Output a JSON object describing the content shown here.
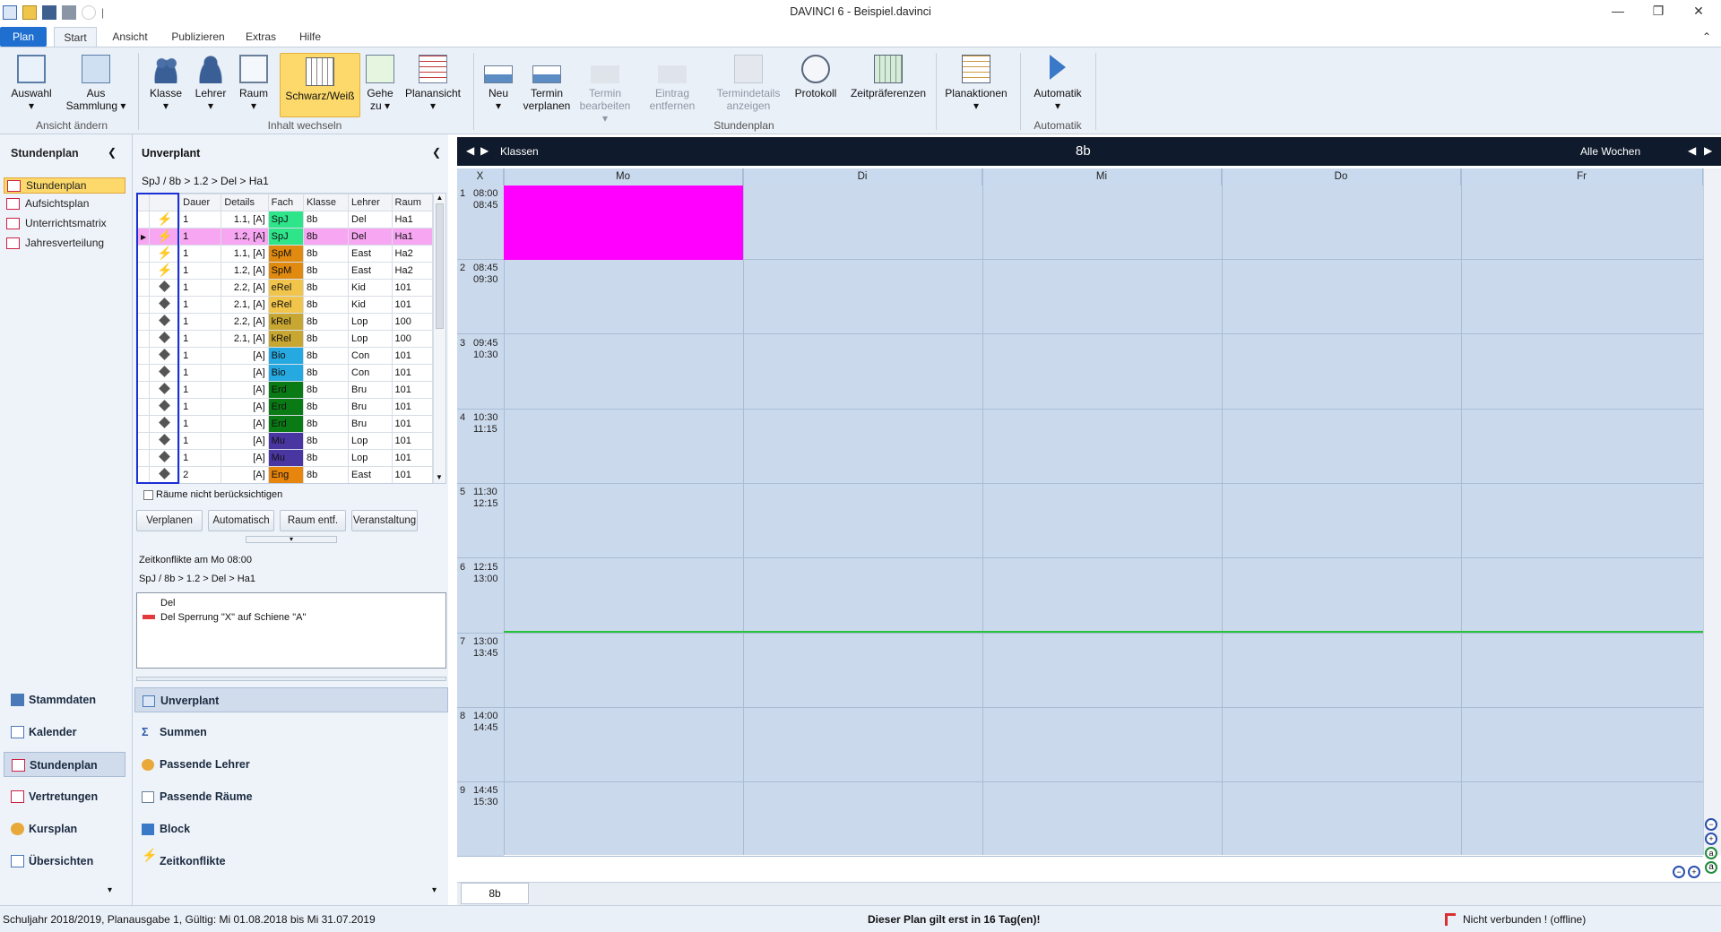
{
  "window": {
    "title": "DAVINCI 6 - Beispiel.davinci"
  },
  "tabs": [
    "Plan",
    "Start",
    "Ansicht",
    "Publizieren",
    "Extras",
    "Hilfe"
  ],
  "ribbon": {
    "auswahl": "Auswahl",
    "aus_sammlung_1": "Aus",
    "aus_sammlung_2": "Sammlung",
    "group_ansicht": "Ansicht ändern",
    "klasse": "Klasse",
    "lehrer": "Lehrer",
    "raum": "Raum",
    "schwarzweiss": "Schwarz/Weiß",
    "gehe_1": "Gehe",
    "gehe_2": "zu",
    "planansicht": "Planansicht",
    "group_inhalt": "Inhalt wechseln",
    "neu": "Neu",
    "termin_1": "Termin",
    "termin_2": "verplanen",
    "termin_bearb_1": "Termin",
    "termin_bearb_2": "bearbeiten",
    "eintrag_1": "Eintrag",
    "eintrag_2": "entfernen",
    "termindetails_1": "Termindetails",
    "termindetails_2": "anzeigen",
    "protokoll": "Protokoll",
    "zeitpraef": "Zeitpräferenzen",
    "group_stundenplan": "Stundenplan",
    "planaktionen": "Planaktionen",
    "automatik": "Automatik",
    "group_automatik": "Automatik"
  },
  "nav": {
    "header": "Stundenplan",
    "items": [
      "Stundenplan",
      "Aufsichtsplan",
      "Unterrichtsmatrix",
      "Jahresverteilung"
    ],
    "bottom": [
      "Stammdaten",
      "Kalender",
      "Stundenplan",
      "Vertretungen",
      "Kursplan",
      "Übersichten"
    ]
  },
  "unverplant": {
    "header": "Unverplant",
    "breadcrumb": "SpJ / 8b > 1.2 > Del > Ha1",
    "columns": [
      "Dauer",
      "Details",
      "Fach",
      "Klasse",
      "Lehrer",
      "Raum"
    ],
    "rows": [
      {
        "icon": "lightning",
        "dauer": "1",
        "details": "1.1, [A]",
        "fach": "SpJ",
        "fcolor": "#2ee58a",
        "klasse": "8b",
        "lehrer": "Del",
        "raum": "Ha1"
      },
      {
        "icon": "lightning",
        "dauer": "1",
        "details": "1.2, [A]",
        "fach": "SpJ",
        "fcolor": "#2ee58a",
        "klasse": "8b",
        "lehrer": "Del",
        "raum": "Ha1",
        "selected": true
      },
      {
        "icon": "lightning",
        "dauer": "1",
        "details": "1.1, [A]",
        "fach": "SpM",
        "fcolor": "#e08a10",
        "klasse": "8b",
        "lehrer": "East",
        "raum": "Ha2"
      },
      {
        "icon": "lightning",
        "dauer": "1",
        "details": "1.2, [A]",
        "fach": "SpM",
        "fcolor": "#e08a10",
        "klasse": "8b",
        "lehrer": "East",
        "raum": "Ha2"
      },
      {
        "icon": "diamond",
        "dauer": "1",
        "details": "2.2, [A]",
        "fach": "eRel",
        "fcolor": "#f1c44c",
        "klasse": "8b",
        "lehrer": "Kid",
        "raum": "101"
      },
      {
        "icon": "diamond",
        "dauer": "1",
        "details": "2.1, [A]",
        "fach": "eRel",
        "fcolor": "#f1c44c",
        "klasse": "8b",
        "lehrer": "Kid",
        "raum": "101"
      },
      {
        "icon": "diamond",
        "dauer": "1",
        "details": "2.2, [A]",
        "fach": "kRel",
        "fcolor": "#c7a632",
        "klasse": "8b",
        "lehrer": "Lop",
        "raum": "100"
      },
      {
        "icon": "diamond",
        "dauer": "1",
        "details": "2.1, [A]",
        "fach": "kRel",
        "fcolor": "#c7a632",
        "klasse": "8b",
        "lehrer": "Lop",
        "raum": "100"
      },
      {
        "icon": "diamond",
        "dauer": "1",
        "details": "[A]",
        "fach": "Bio",
        "fcolor": "#26a9e0",
        "klasse": "8b",
        "lehrer": "Con",
        "raum": "101"
      },
      {
        "icon": "diamond",
        "dauer": "1",
        "details": "[A]",
        "fach": "Bio",
        "fcolor": "#26a9e0",
        "klasse": "8b",
        "lehrer": "Con",
        "raum": "101"
      },
      {
        "icon": "diamond",
        "dauer": "1",
        "details": "[A]",
        "fach": "Erd",
        "fcolor": "#0a7a14",
        "klasse": "8b",
        "lehrer": "Bru",
        "raum": "101"
      },
      {
        "icon": "diamond",
        "dauer": "1",
        "details": "[A]",
        "fach": "Erd",
        "fcolor": "#0a7a14",
        "klasse": "8b",
        "lehrer": "Bru",
        "raum": "101"
      },
      {
        "icon": "diamond",
        "dauer": "1",
        "details": "[A]",
        "fach": "Erd",
        "fcolor": "#0a7a14",
        "klasse": "8b",
        "lehrer": "Bru",
        "raum": "101"
      },
      {
        "icon": "diamond",
        "dauer": "1",
        "details": "[A]",
        "fach": "Mu",
        "fcolor": "#4a36a0",
        "klasse": "8b",
        "lehrer": "Lop",
        "raum": "101"
      },
      {
        "icon": "diamond",
        "dauer": "1",
        "details": "[A]",
        "fach": "Mu",
        "fcolor": "#4a36a0",
        "klasse": "8b",
        "lehrer": "Lop",
        "raum": "101"
      },
      {
        "icon": "diamond",
        "dauer": "2",
        "details": "[A]",
        "fach": "Eng",
        "fcolor": "#e8850c",
        "klasse": "8b",
        "lehrer": "East",
        "raum": "101"
      }
    ],
    "checkbox_label": "Räume nicht berücksichtigen",
    "buttons": [
      "Verplanen",
      "Automatisch",
      "Raum entf.",
      "Veranstaltung"
    ],
    "conflict_title": "Zeitkonflikte am Mo 08:00",
    "conflict_path": "SpJ / 8b > 1.2 > Del > Ha1",
    "conflicts": [
      "Del",
      "Del Sperrung \"X\" auf Schiene \"A\""
    ],
    "bottom": [
      "Unverplant",
      "Summen",
      "Passende Lehrer",
      "Passende Räume",
      "Block",
      "Zeitkonflikte"
    ]
  },
  "calendar": {
    "left_label": "Klassen",
    "center": "8b",
    "right_label": "Alle Wochen",
    "corner": "X",
    "days": [
      "Mo",
      "Di",
      "Mi",
      "Do",
      "Fr"
    ],
    "slots": [
      [
        "1",
        "08:00",
        "08:45"
      ],
      [
        "2",
        "08:45",
        "09:30"
      ],
      [
        "3",
        "09:45",
        "10:30"
      ],
      [
        "4",
        "10:30",
        "11:15"
      ],
      [
        "5",
        "11:30",
        "12:15"
      ],
      [
        "6",
        "12:15",
        "13:00"
      ],
      [
        "7",
        "13:00",
        "13:45"
      ],
      [
        "8",
        "14:00",
        "14:45"
      ],
      [
        "9",
        "14:45",
        "15:30"
      ]
    ],
    "highlight_color": "#ff00ff",
    "current_time_color": "#27c23a",
    "sheet_tab": "8b"
  },
  "status": {
    "left": "Schuljahr 2018/2019, Planausgabe 1, Gültig: Mi 01.08.2018 bis Mi 31.07.2019",
    "center": "Dieser Plan gilt erst in 16 Tag(en)!",
    "right": "Nicht verbunden ! (offline)"
  }
}
